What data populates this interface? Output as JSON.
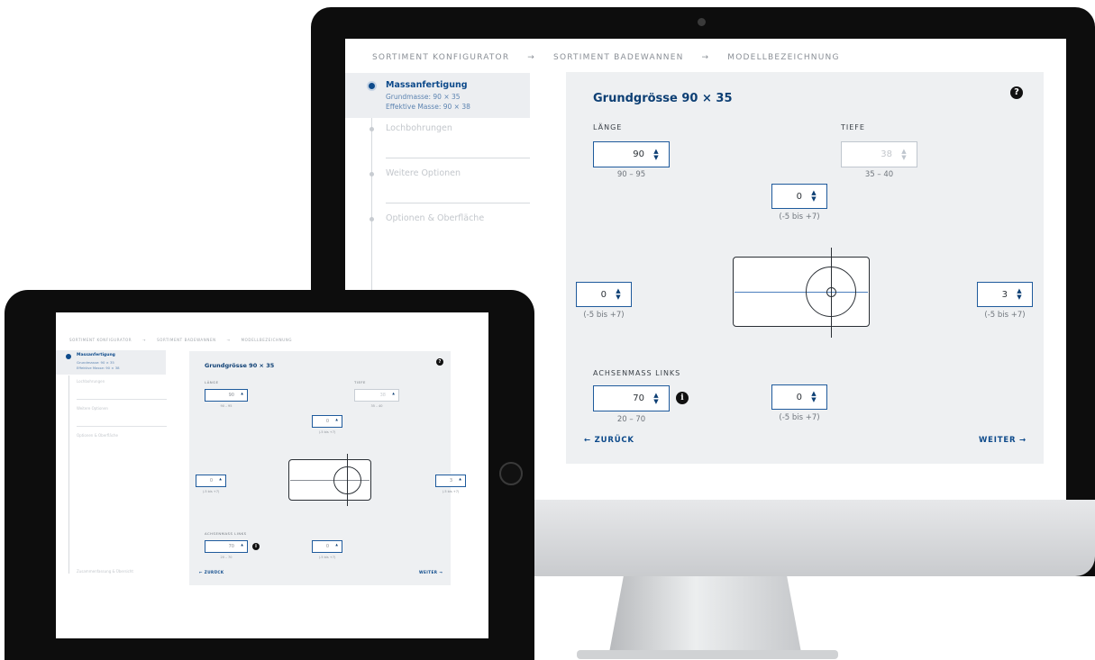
{
  "breadcrumb": [
    "SORTIMENT KONFIGURATOR",
    "SORTIMENT BADEWANNEN",
    "MODELLBEZEICHNUNG"
  ],
  "breadcrumb_separator": "→",
  "steps": {
    "active_title": "Massanfertigung",
    "active_sub1": "Grundmasse: 90 × 35",
    "active_sub2": "Effektive Masse: 90 × 38",
    "step2": "Lochbohrungen",
    "step3": "Weitere Optionen",
    "step4": "Optionen & Oberfläche"
  },
  "panel": {
    "title": "Grundgrösse 90 × 35",
    "help": "?",
    "laenge_label": "LÄNGE",
    "laenge_value": "90",
    "laenge_range": "90 – 95",
    "tiefe_label": "TIEFE",
    "tiefe_value": "38",
    "tiefe_range": "35 – 40",
    "top_value": "0",
    "top_range": "(-5 bis +7)",
    "left_value": "0",
    "left_range": "(-5 bis +7)",
    "right_value": "3",
    "right_range": "(-5 bis +7)",
    "achsen_label": "ACHSENMASS LINKS",
    "achsen_value": "70",
    "achsen_range": "20 – 70",
    "bottom_value": "0",
    "bottom_range": "(-5 bis +7)",
    "back": "← ZURÜCK",
    "next": "WEITER →",
    "info": "i",
    "up_arrow": "▲",
    "down_arrow": "▼"
  },
  "ipad": {
    "extra_step": "Zusammenfassung & Übersicht"
  }
}
